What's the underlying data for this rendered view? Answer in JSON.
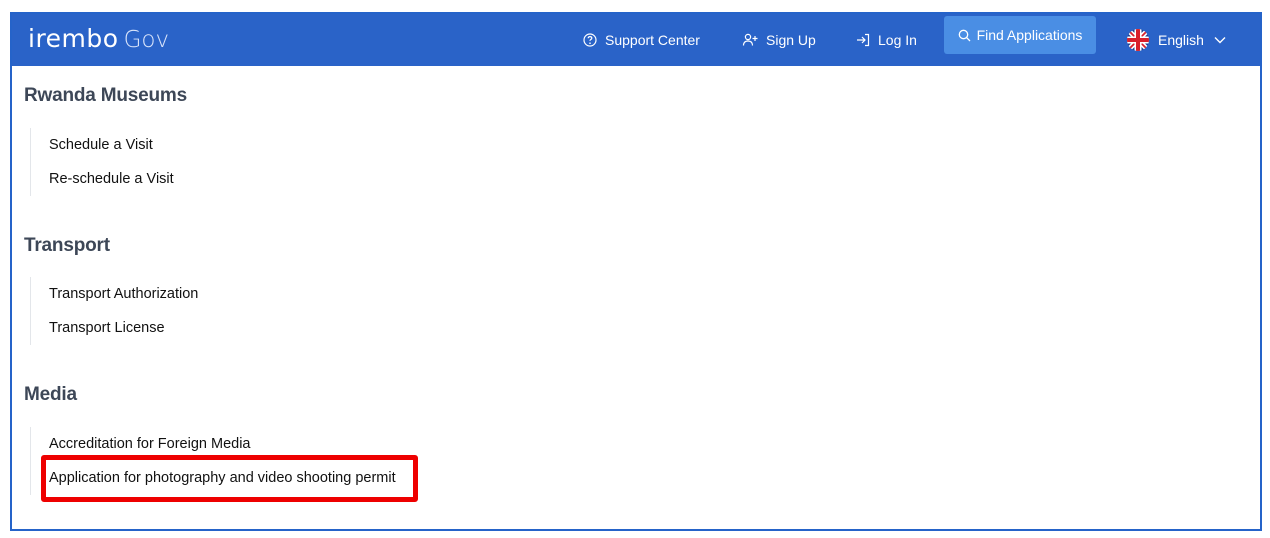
{
  "header": {
    "logo_main": "irembo",
    "logo_suffix": "Gov",
    "support_label": "Support Center",
    "signup_label": "Sign Up",
    "login_label": "Log In",
    "find_label": "Find Applications",
    "language_label": "English",
    "bar_color": "#2a63c8",
    "find_bg_color": "#4a8ee4"
  },
  "sections": [
    {
      "title": "Rwanda Museums",
      "items": [
        "Schedule a Visit",
        "Re-schedule a Visit"
      ]
    },
    {
      "title": "Transport",
      "items": [
        "Transport Authorization",
        "Transport License"
      ]
    },
    {
      "title": "Media",
      "items": [
        "Accreditation for Foreign Media",
        "Application for photography and video shooting permit"
      ]
    }
  ],
  "highlight_color": "#ee0000",
  "icons": {
    "support": "question-circle-icon",
    "signup": "user-plus-icon",
    "login": "login-arrow-icon",
    "find": "search-icon",
    "language": "uk-flag-icon",
    "dropdown": "chevron-down-icon"
  }
}
